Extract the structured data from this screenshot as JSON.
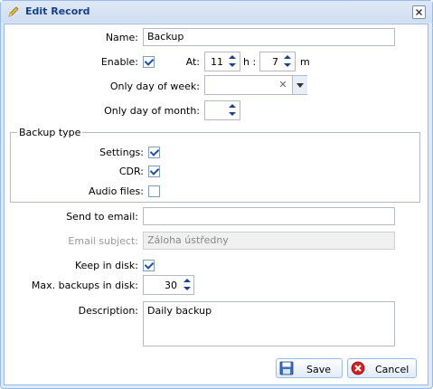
{
  "window": {
    "title": "Edit Record"
  },
  "form": {
    "name_label": "Name:",
    "name_value": "Backup",
    "enable_label": "Enable:",
    "enable_checked": true,
    "at_label": "At:",
    "hour_value": "11",
    "hour_unit": "h :",
    "minute_value": "7",
    "minute_unit": "m",
    "day_of_week_label": "Only day of week:",
    "day_of_week_value": "",
    "day_of_month_label": "Only day of month:",
    "day_of_month_value": "",
    "backup_type": {
      "legend": "Backup type",
      "settings_label": "Settings:",
      "settings_checked": true,
      "cdr_label": "CDR:",
      "cdr_checked": true,
      "audio_label": "Audio files:",
      "audio_checked": false
    },
    "send_email_label": "Send to email:",
    "send_email_value": "",
    "email_subject_label": "Email subject:",
    "email_subject_placeholder": "Záloha ústředny",
    "keep_disk_label": "Keep in disk:",
    "keep_disk_checked": true,
    "max_backups_label": "Max. backups in disk:",
    "max_backups_value": "30",
    "description_label": "Description:",
    "description_value": "Daily backup"
  },
  "buttons": {
    "save": "Save",
    "cancel": "Cancel"
  },
  "colors": {
    "accent": "#15428b",
    "border": "#99bbe8",
    "cancel_red": "#d42020"
  }
}
